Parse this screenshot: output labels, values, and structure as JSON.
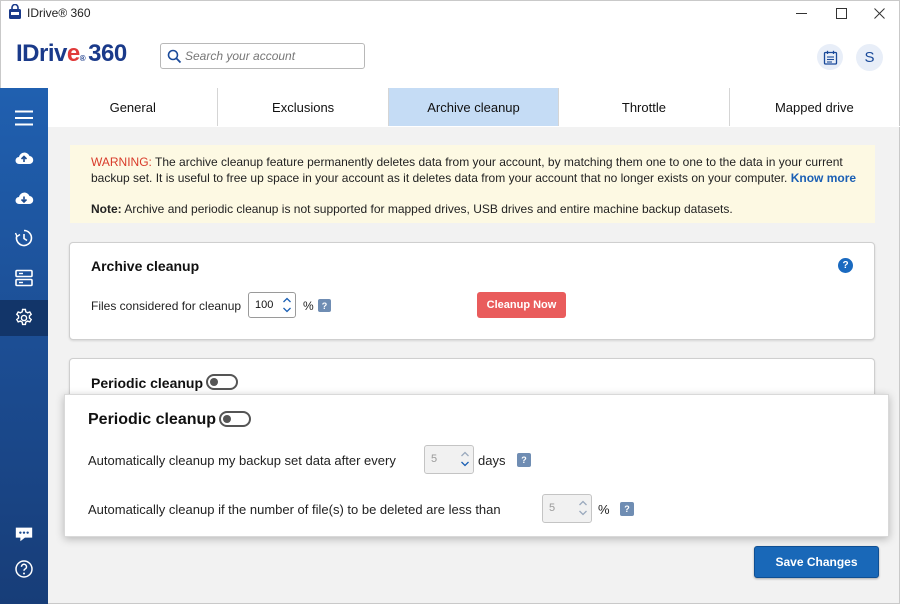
{
  "window": {
    "title": "IDrive® 360",
    "controls": [
      "minimize",
      "maximize",
      "close"
    ]
  },
  "header": {
    "logo_text": "IDriv",
    "logo_e": "e",
    "logo_reg": "®",
    "logo_suffix": "360",
    "search_placeholder": "Search your account",
    "avatar_initial": "S"
  },
  "sidebar": {
    "items": [
      {
        "icon": "menu-icon"
      },
      {
        "icon": "cloud-upload-icon"
      },
      {
        "icon": "cloud-download-icon"
      },
      {
        "icon": "history-icon"
      },
      {
        "icon": "servers-icon"
      },
      {
        "icon": "gear-icon",
        "active": true
      },
      {
        "icon": "chat-icon"
      },
      {
        "icon": "help-icon"
      }
    ]
  },
  "tabs": [
    {
      "label": "General"
    },
    {
      "label": "Exclusions"
    },
    {
      "label": "Archive cleanup",
      "active": true
    },
    {
      "label": "Throttle"
    },
    {
      "label": "Mapped drive"
    }
  ],
  "warning": {
    "label": "WARNING:",
    "text": " The archive cleanup feature permanently deletes data from your account, by matching them one to one to the data in your current backup set. It is useful to free up space in your account as it deletes data from your account that no longer exists on your computer. ",
    "link": "Know more",
    "note_label": "Note:",
    "note_text": "  Archive and periodic cleanup is not supported for mapped drives, USB drives and entire machine backup datasets."
  },
  "archive_cleanup": {
    "title": "Archive cleanup",
    "files_label": "Files considered for cleanup",
    "files_value": "100",
    "percent": "%",
    "help": "?",
    "button": "Cleanup Now"
  },
  "periodic_cleanup": {
    "title": "Periodic cleanup",
    "enabled": false,
    "days_label": "Automatically cleanup my backup set data after every",
    "days_value": "5",
    "days_unit": "days",
    "files_label": "Automatically cleanup if the number of file(s) to be deleted  are less than",
    "files_value": "5",
    "percent": "%",
    "help": "?"
  },
  "footer": {
    "save_button": "Save Changes"
  },
  "colors": {
    "brand_blue": "#1a3a8a",
    "accent_red": "#e03a3a",
    "sidebar_blue": "#1b4a8e",
    "active_tab": "#c5dcf5",
    "cleanup_button": "#e95c5c",
    "save_button": "#1968b8"
  }
}
